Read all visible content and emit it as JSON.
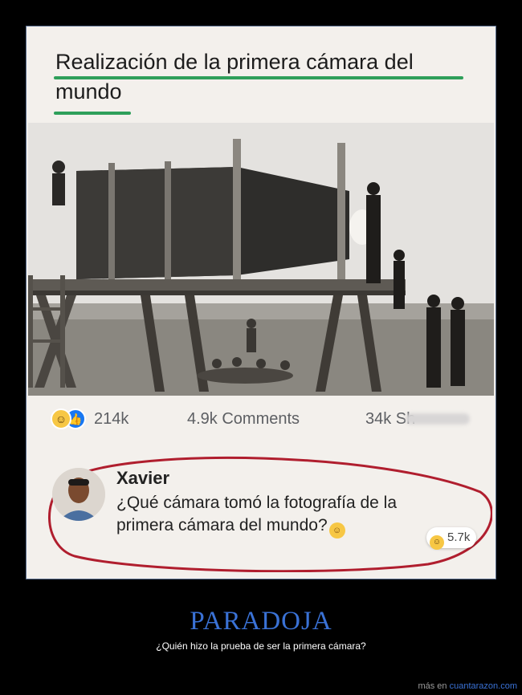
{
  "post": {
    "headline": "Realización de la primera cámara del mundo",
    "photo_alt": "Realización de la primera cámara del mundo",
    "reactions": {
      "count": "214k",
      "comments": "4.9k Comments",
      "shares": "34k Sh"
    }
  },
  "comment": {
    "author": "Xavier",
    "text": "¿Qué cámara tomó la fotografía de la primera cámara del mundo?",
    "reaction_count": "5.7k"
  },
  "caption": {
    "title": "PARADOJA",
    "subtitle": "¿Quién hizo la prueba de ser la primera cámara?"
  },
  "footer": {
    "prefix": "más en ",
    "site": "cuantarazon.com"
  },
  "colors": {
    "underline": "#2e9f5a",
    "ellipse": "#b01e2e",
    "title_blue": "#3a72d6",
    "like_blue": "#1877f2"
  }
}
